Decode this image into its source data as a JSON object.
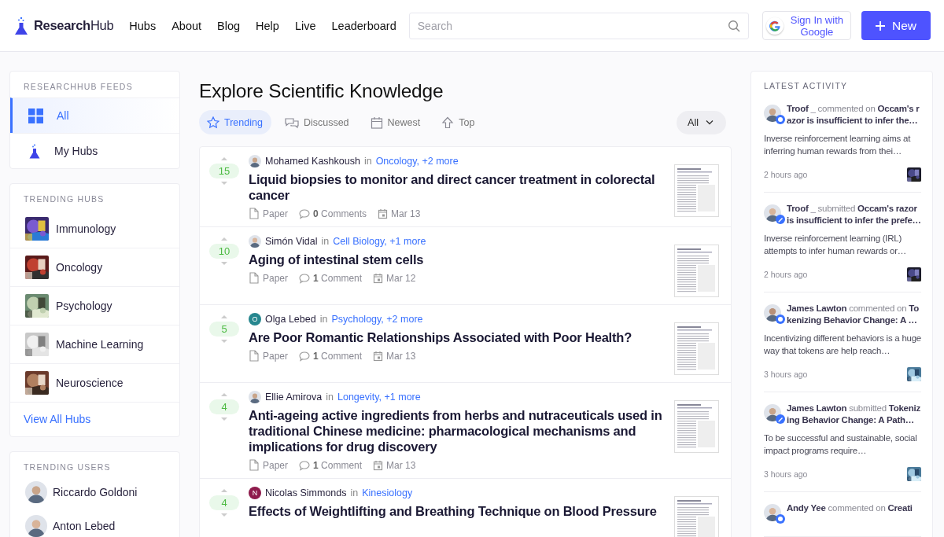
{
  "header": {
    "logo": "**Research**Hub",
    "nav": [
      "Hubs",
      "About",
      "Blog",
      "Help",
      "Live",
      "Leaderboard"
    ],
    "search": {
      "placeholder": "Search"
    },
    "sign_in": "Sign In with Google",
    "new_button": "New"
  },
  "sidebar": {
    "feeds": {
      "title": "RESEARCHHUB FEEDS",
      "items": [
        {
          "label": "All",
          "kind": "grid",
          "selected": true
        },
        {
          "label": "My Hubs",
          "kind": "flask",
          "selected": false
        }
      ]
    },
    "trending_hubs": {
      "title": "TRENDING HUBS",
      "items": [
        "Immunology",
        "Oncology",
        "Psychology",
        "Machine Learning",
        "Neuroscience"
      ],
      "view_all": "View All Hubs"
    },
    "trending_users": {
      "title": "TRENDING USERS",
      "items": [
        "Riccardo Goldoni",
        "Anton Lebed"
      ]
    }
  },
  "feed": {
    "title": "Explore Scientific Knowledge",
    "tabs": [
      {
        "label": "Trending",
        "kind": "star",
        "selected": true
      },
      {
        "label": "Discussed",
        "kind": "chat",
        "selected": false
      },
      {
        "label": "Newest",
        "kind": "calendar",
        "selected": false
      },
      {
        "label": "Top",
        "kind": "arrow",
        "selected": false
      }
    ],
    "filter": "All",
    "posts": [
      {
        "score": "15",
        "author": "Mohamed Kashkoush",
        "in": "in",
        "hubs": "Oncology, +2 more",
        "title": "Liquid biopsies to monitor and direct cancer treatment in colorectal cancer",
        "type": "Paper",
        "comments": "**0** Comments",
        "date": "Mar 13"
      },
      {
        "score": "10",
        "author": "Simón Vidal",
        "in": "in",
        "hubs": "Cell Biology, +1 more",
        "title": "Aging of intestinal stem cells",
        "type": "Paper",
        "comments": "**1** Comment",
        "date": "Mar 12"
      },
      {
        "score": "5",
        "author": "Olga Lebed",
        "avatar": {
          "kind": "initial",
          "letter": "O",
          "color": "#27878f"
        },
        "in": "in",
        "hubs": "Psychology, +2 more",
        "title": "Are Poor Romantic Relationships Associated with Poor Health?",
        "type": "Paper",
        "comments": "**1** Comment",
        "date": "Mar 13"
      },
      {
        "score": "4",
        "author": "Ellie Amirova",
        "in": "in",
        "hubs": "Longevity, +1 more",
        "title": "Anti-ageing active ingredients from herbs and nutraceuticals used in traditional Chinese medicine: pharmacological mechanisms and implications for drug discovery",
        "type": "Paper",
        "comments": "**1** Comment",
        "date": "Mar 13"
      },
      {
        "score": "4",
        "author": "Nicolas Simmonds",
        "avatar": {
          "kind": "initial",
          "letter": "N",
          "color": "#8e1b4c"
        },
        "in": "in",
        "hubs": "Kinesiology",
        "title": "Effects of Weightlifting and Breathing Technique on Blood Pressure"
      }
    ]
  },
  "activity": {
    "title": "LATEST ACTIVITY",
    "items": [
      {
        "user": "Troof _",
        "action": "commented on",
        "kind": "comment",
        "target": "Occam's razor is insufficient to infer the…",
        "snippet": "Inverse reinforcement learning aims at inferring human rewards from thei…",
        "time": "2 hours ago"
      },
      {
        "user": "Troof _",
        "action": "submitted",
        "kind": "submit",
        "target": "Occam's razor is insufficient to infer the prefe…",
        "snippet": "Inverse reinforcement learning (IRL) attempts to infer human rewards or…",
        "time": "2 hours ago"
      },
      {
        "user": "James Lawton",
        "action": "commented on",
        "kind": "comment",
        "target": "Tokenizing Behavior Change: A …",
        "snippet": "Incentivizing different behaviors is a huge way that tokens are help reach…",
        "time": "3 hours ago"
      },
      {
        "user": "James Lawton",
        "action": "submitted",
        "kind": "submit",
        "target": "Tokenizing Behavior Change: A Path…",
        "snippet": "To be successful and sustainable, social impact programs require…",
        "time": "3 hours ago"
      },
      {
        "user": "Andy Yee",
        "action": "commented on",
        "kind": "comment",
        "target": "Creati"
      }
    ]
  }
}
